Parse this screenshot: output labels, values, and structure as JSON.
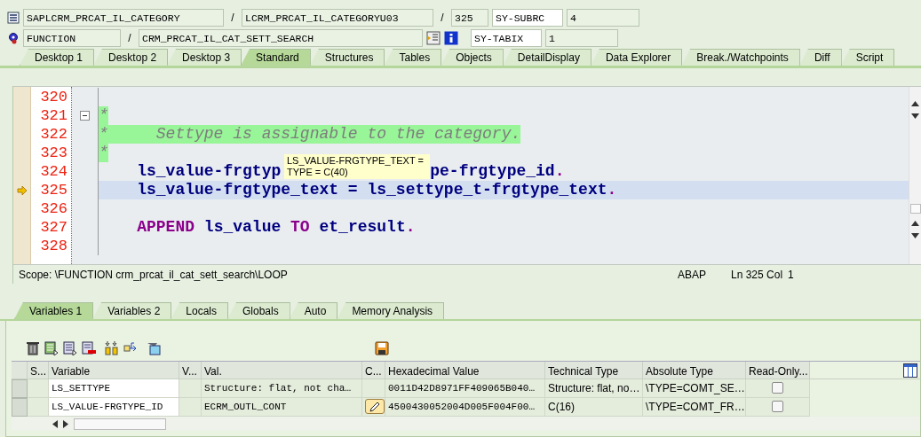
{
  "header": {
    "program": "SAPLCRM_PRCAT_IL_CATEGORY",
    "sep1": "/",
    "include": "LCRM_PRCAT_IL_CATEGORYU03",
    "sep2": "/",
    "line": "325",
    "event_type": "FUNCTION",
    "sep3": "/",
    "event_name": "CRM_PRCAT_IL_CAT_SETT_SEARCH",
    "sysvars": [
      {
        "name": "SY-SUBRC",
        "value": "4"
      },
      {
        "name": "SY-TABIX",
        "value": "1"
      }
    ]
  },
  "tabs": [
    {
      "label": "Desktop 1",
      "selected": false
    },
    {
      "label": "Desktop 2",
      "selected": false
    },
    {
      "label": "Desktop 3",
      "selected": false
    },
    {
      "label": "Standard",
      "selected": true
    },
    {
      "label": "Structures",
      "selected": false
    },
    {
      "label": "Tables",
      "selected": false
    },
    {
      "label": "Objects",
      "selected": false
    },
    {
      "label": "DetailDisplay",
      "selected": false
    },
    {
      "label": "Data Explorer",
      "selected": false
    },
    {
      "label": "Break./Watchpoints",
      "selected": false
    },
    {
      "label": "Diff",
      "selected": false
    },
    {
      "label": "Script",
      "selected": false
    }
  ],
  "editor": {
    "lines": [
      {
        "number": "320",
        "current": false,
        "fold_marker": false
      },
      {
        "number": "321",
        "current": false,
        "fold_marker": true,
        "tokens": [
          {
            "kind": "comment",
            "text": "*"
          }
        ]
      },
      {
        "number": "322",
        "current": false,
        "fold_marker": false,
        "tokens": [
          {
            "kind": "comment",
            "text": "*     Settype is assignable to the category."
          }
        ]
      },
      {
        "number": "323",
        "current": false,
        "fold_marker": false,
        "tokens": [
          {
            "kind": "comment",
            "text": "*"
          }
        ]
      },
      {
        "number": "324",
        "current": false,
        "fold_marker": false,
        "tokens": [
          {
            "kind": "ident",
            "text": "    ls_value-frgtyp"
          },
          {
            "kind": "covered",
            "text": "pe-frgtype_id"
          },
          {
            "kind": "punct",
            "text": "."
          }
        ]
      },
      {
        "number": "325",
        "current": true,
        "fold_marker": false,
        "tokens": [
          {
            "kind": "ident",
            "text": "    ls_value-frgtype_text = ls_settype_t-frgtype_text"
          },
          {
            "kind": "punct",
            "text": "."
          }
        ]
      },
      {
        "number": "326",
        "current": false,
        "fold_marker": false
      },
      {
        "number": "327",
        "current": false,
        "fold_marker": false,
        "tokens": [
          {
            "kind": "keyword",
            "text": "    APPEND"
          },
          {
            "kind": "ident",
            "text": " ls_value "
          },
          {
            "kind": "keyword",
            "text": "TO"
          },
          {
            "kind": "ident",
            "text": " et_result"
          },
          {
            "kind": "punct",
            "text": "."
          }
        ]
      },
      {
        "number": "328",
        "current": false,
        "fold_marker": false
      }
    ],
    "tooltip": [
      "LS_VALUE-FRGTYPE_TEXT =",
      "TYPE  = C(40)"
    ]
  },
  "status_bar": {
    "scope": "Scope: \\FUNCTION crm_prcat_il_cat_sett_search\\LOOP",
    "language": "ABAP",
    "position": "Ln 325 Col",
    "column": "1"
  },
  "var_tabs": [
    {
      "label": "Variables 1",
      "selected": true
    },
    {
      "label": "Variables 2",
      "selected": false
    },
    {
      "label": "Locals",
      "selected": false
    },
    {
      "label": "Globals",
      "selected": false
    },
    {
      "label": "Auto",
      "selected": false
    },
    {
      "label": "Memory Analysis",
      "selected": false
    }
  ],
  "table": {
    "columns": [
      "S...",
      "Variable",
      "V...",
      "Val.",
      "C...",
      "Hexadecimal Value",
      "Technical Type",
      "Absolute Type",
      "Read-Only..."
    ],
    "rows": [
      {
        "variable": "LS_SETTYPE",
        "value": "Structure: flat, not cha…",
        "edit_button": false,
        "hex": "0011D42D8971FF409065B040…",
        "technical_type": "Structure: flat, no…",
        "absolute_type": "\\TYPE=COMT_SE…",
        "read_only": false
      },
      {
        "variable": "LS_VALUE-FRGTYPE_ID",
        "value": "ECRM_OUTL_CONT",
        "edit_button": true,
        "hex": "4500430052004D005F004F00…",
        "technical_type": "C(16)",
        "absolute_type": "\\TYPE=COMT_FR…",
        "read_only": false
      }
    ]
  }
}
